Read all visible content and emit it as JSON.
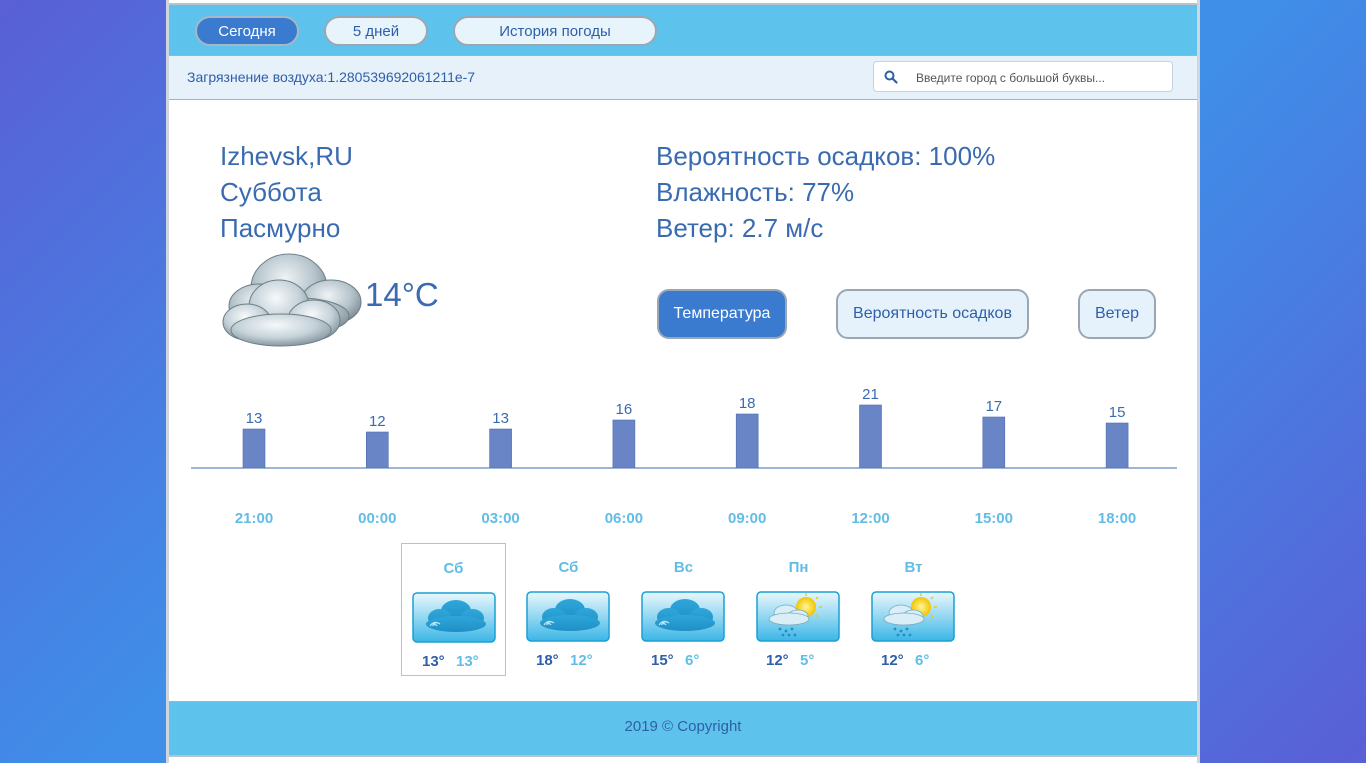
{
  "tabs": [
    "Сегодня",
    "5 дней",
    "История погоды"
  ],
  "active_tab": 0,
  "pollution_text": "Загрязнение воздуха:1.280539692061211e-7",
  "search": {
    "placeholder": "Введите город с большой буквы..."
  },
  "current": {
    "city": "Izhevsk,RU",
    "day": "Суббота",
    "condition": "Пасмурно",
    "temperature": "14°C",
    "precipitation": "Вероятность осадков: 100%",
    "humidity": "Влажность: 77%",
    "wind": "Ветер: 2.7 м/с",
    "icon": "cloudy-icon"
  },
  "chart_buttons": [
    "Температура",
    "Вероятность осадков",
    "Ветер"
  ],
  "active_chart_button": 0,
  "chart_data": {
    "type": "bar",
    "categories": [
      "21:00",
      "00:00",
      "03:00",
      "06:00",
      "09:00",
      "12:00",
      "15:00",
      "18:00"
    ],
    "values": [
      13,
      12,
      13,
      16,
      18,
      21,
      17,
      15
    ],
    "title": "",
    "xlabel": "",
    "ylabel": "",
    "ylim": [
      0,
      21
    ],
    "grid": false,
    "bar_color": "#6a85c6",
    "label_color": "#3a6bb0",
    "tick_color": "#62bde6"
  },
  "forecast": [
    {
      "day": "Сб",
      "hi": "13°",
      "lo": "13°",
      "icon": "cloudy-icon",
      "selected": true
    },
    {
      "day": "Сб",
      "hi": "18°",
      "lo": "12°",
      "icon": "cloudy-icon",
      "selected": false
    },
    {
      "day": "Вс",
      "hi": "15°",
      "lo": "6°",
      "icon": "cloudy-icon",
      "selected": false
    },
    {
      "day": "Пн",
      "hi": "12°",
      "lo": "5°",
      "icon": "sun-rain-icon",
      "selected": false
    },
    {
      "day": "Вт",
      "hi": "12°",
      "lo": "6°",
      "icon": "sun-rain-icon",
      "selected": false
    }
  ],
  "footer": "2019 © Copyright",
  "colors": {
    "accent": "#3a7bd0",
    "header": "#5ec3ec",
    "text": "#3a6bb0"
  }
}
